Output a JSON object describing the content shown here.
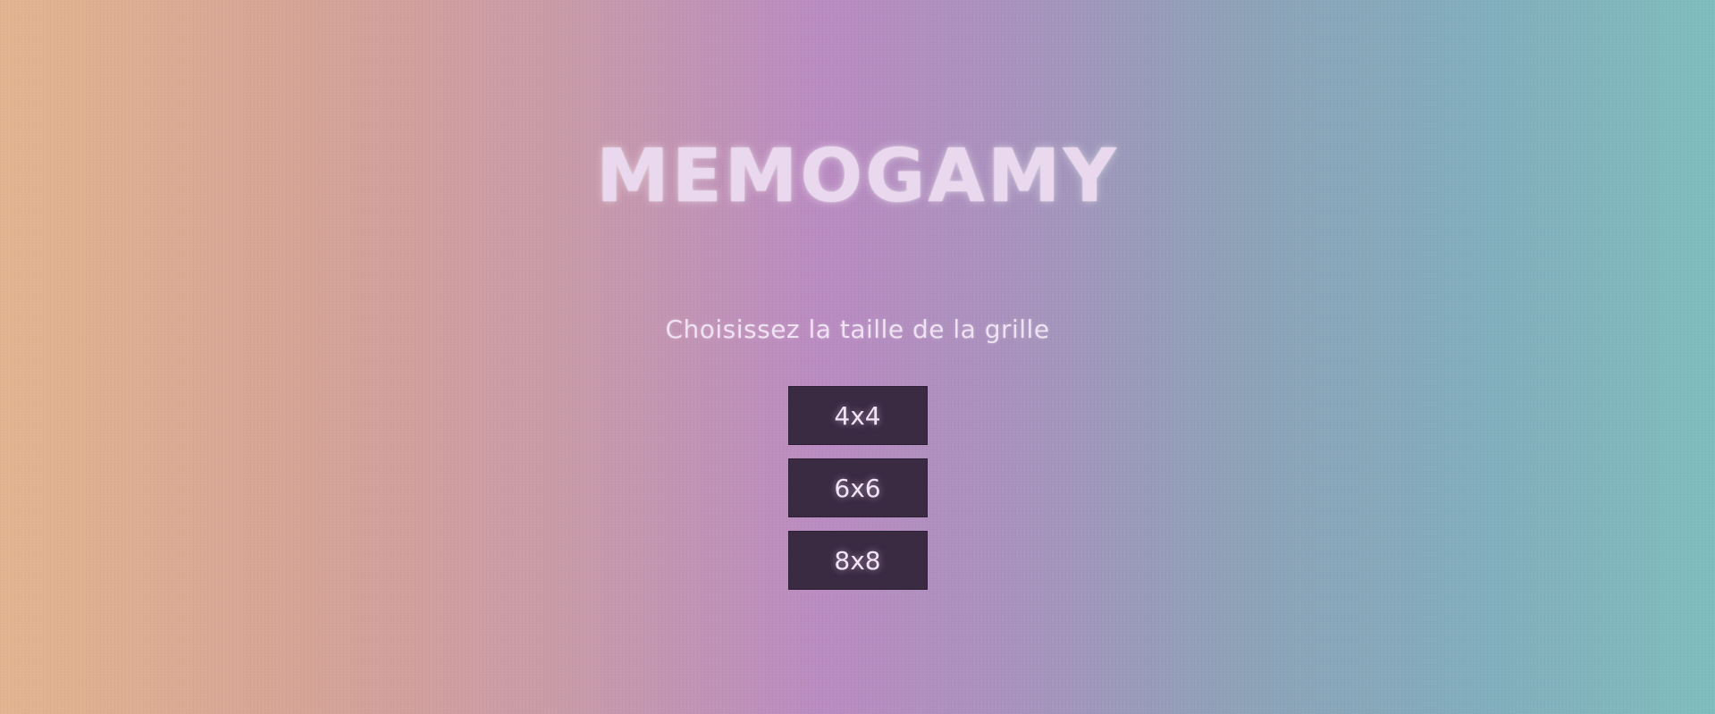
{
  "game": {
    "title": "MEMOGAMY",
    "subtitle": "Choisissez la taille de la grille"
  },
  "grid_sizes": [
    {
      "label": "4x4"
    },
    {
      "label": "6x6"
    },
    {
      "label": "8x8"
    }
  ],
  "colors": {
    "gradient_left": "#e3b48f",
    "gradient_mid": "#ba8bc2",
    "gradient_right": "#7fbdbd",
    "button_bg": "#3a2a42",
    "text_light": "#ead8ee"
  }
}
